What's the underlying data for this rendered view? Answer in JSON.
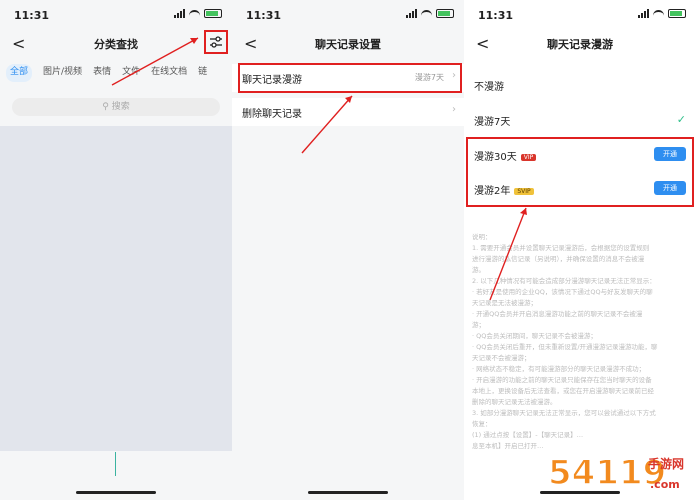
{
  "status": {
    "time": "11:31"
  },
  "screen1": {
    "back": "<",
    "title": "分类查找",
    "filter_icon": "sliders-icon",
    "tabs": [
      "全部",
      "图片/视频",
      "表情",
      "文件",
      "在线文档",
      "链"
    ],
    "search_placeholder": "搜索"
  },
  "screen2": {
    "back": "<",
    "title": "聊天记录设置",
    "roaming_label": "聊天记录漫游",
    "roaming_value": "漫游7天",
    "delete_label": "删除聊天记录"
  },
  "screen3": {
    "back": "<",
    "title": "聊天记录漫游",
    "options": [
      {
        "label": "不漫游"
      },
      {
        "label": "漫游7天"
      },
      {
        "label": "漫游30天",
        "badge": "VIP",
        "button": "开通"
      },
      {
        "label": "漫游2年",
        "badge": "SVIP",
        "button": "开通"
      }
    ],
    "notes": [
      "说明：",
      "1. 需要开通会员并设置聊天记录漫游后，会根据您的设置规则",
      "进行漫游的私信记录（另说明），并确保设置的消息不会被漫",
      "游。",
      "2. 以下几种情况有可能会造成部分漫游聊天记录无法正常显示：",
      "· 若好友是使用的企业QQ，该情况下通过QQ与好友发聊天的聊",
      "天记录是无法被漫游；",
      "· 开通QQ会员并开启消息漫游功能之前的聊天记录不会被漫",
      "游；",
      "· QQ会员关闭期间，聊天记录不会被漫游；",
      "· QQ会员关闭后重开，但未重新设置/开通漫游记录漫游功能，聊",
      "天记录不会被漫游；",
      "· 网络状态不稳定，有可能漫游部分的聊天记录漫游不成功；",
      "· 开启漫游的功能之前的聊天记录只能保存在您当时聊天的设备",
      "本地上，更换设备后无法查看，或您在开启漫游聊天记录前已经",
      "删除的聊天记录无法被漫游。",
      "3. 如部分漫游聊天记录无法正常显示，您可以尝试通过以下方式",
      "恢复：",
      "(1) 通过点按【设置】-【聊天记录】…",
      "息至本机】开启已打开…"
    ]
  },
  "watermark": {
    "main": "54119",
    "sub": "手游网",
    "tag": ".com"
  },
  "colors": {
    "accent": "#2e8ef0",
    "highlight": "#e02020",
    "check": "#2fbf8a"
  }
}
